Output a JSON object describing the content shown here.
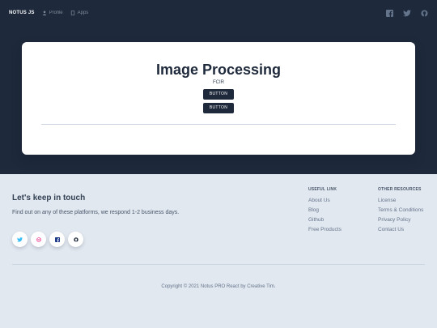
{
  "navbar": {
    "brand": "NOTUS JS",
    "links": [
      {
        "label": "Profile",
        "icon": "user-icon"
      },
      {
        "label": "Apps",
        "icon": "file-icon"
      }
    ],
    "socials": [
      "facebook-icon",
      "twitter-icon",
      "github-icon"
    ]
  },
  "card": {
    "title": "Image Processing",
    "subtitle": "FCIR",
    "buttons": [
      "BUTTON",
      "BUTTON"
    ]
  },
  "footer": {
    "title": "Let's keep in touch",
    "text": "Find out on any of these platforms, we respond 1-2 business days.",
    "socials": [
      {
        "icon": "twitter-icon",
        "color": "#38bdf8"
      },
      {
        "icon": "dribbble-icon",
        "color": "#ec4899"
      },
      {
        "icon": "facebook-icon",
        "color": "#1e3a8a"
      },
      {
        "icon": "github-icon",
        "color": "#1e293b"
      }
    ],
    "useful_links": {
      "heading": "Useful Link",
      "items": [
        "About Us",
        "Blog",
        "Github",
        "Free Products"
      ]
    },
    "other_resources": {
      "heading": "Other Resources",
      "items": [
        "License",
        "Terms & Conditions",
        "Privacy Policy",
        "Contact Us"
      ]
    },
    "copyright": "Copyright © 2021 Notus PRO React by Creative Tim."
  },
  "colors": {
    "hero_bg": "#1e293b",
    "page_bg": "#e2e8f0",
    "button_bg": "#1e293b"
  }
}
